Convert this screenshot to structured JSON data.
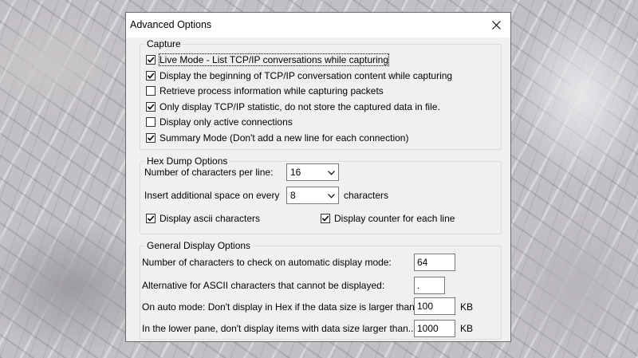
{
  "window": {
    "title": "Advanced Options"
  },
  "capture": {
    "label": "Capture",
    "options": [
      {
        "label": "Live Mode - List TCP/IP conversations while capturing",
        "checked": true
      },
      {
        "label": "Display the beginning of TCP/IP conversation content while capturing",
        "checked": true
      },
      {
        "label": "Retrieve process information while capturing packets",
        "checked": false
      },
      {
        "label": "Only display TCP/IP statistic, do not store the captured data in file.",
        "checked": true
      },
      {
        "label": "Display only active connections",
        "checked": false
      },
      {
        "label": "Summary Mode (Don't add a new line for each connection)",
        "checked": true
      }
    ]
  },
  "hex": {
    "label": "Hex Dump Options",
    "chars_per_line_label": "Number of characters per line:",
    "chars_per_line_value": "16",
    "space_label": "Insert additional space on every",
    "space_value": "8",
    "space_suffix": "characters",
    "ascii_label": "Display ascii characters",
    "ascii_checked": true,
    "counter_label": "Display counter for each line",
    "counter_checked": true
  },
  "general": {
    "label": "General Display Options",
    "auto_check_label": "Number of characters to check on automatic display mode:",
    "auto_check_value": "64",
    "alt_ascii_label": "Alternative for ASCII characters that cannot be displayed:",
    "alt_ascii_value": ".",
    "auto_hex_label": "On auto mode: Don't display in Hex if the data size is larger than",
    "auto_hex_value": "100",
    "auto_hex_unit": "KB",
    "lower_pane_label": "In the lower pane, don't display items with data size larger than...",
    "lower_pane_value": "1000",
    "lower_pane_unit": "KB"
  },
  "icons": {
    "check": "checkmark-icon",
    "close": "close-icon",
    "dropdown": "chevron-down-icon"
  }
}
